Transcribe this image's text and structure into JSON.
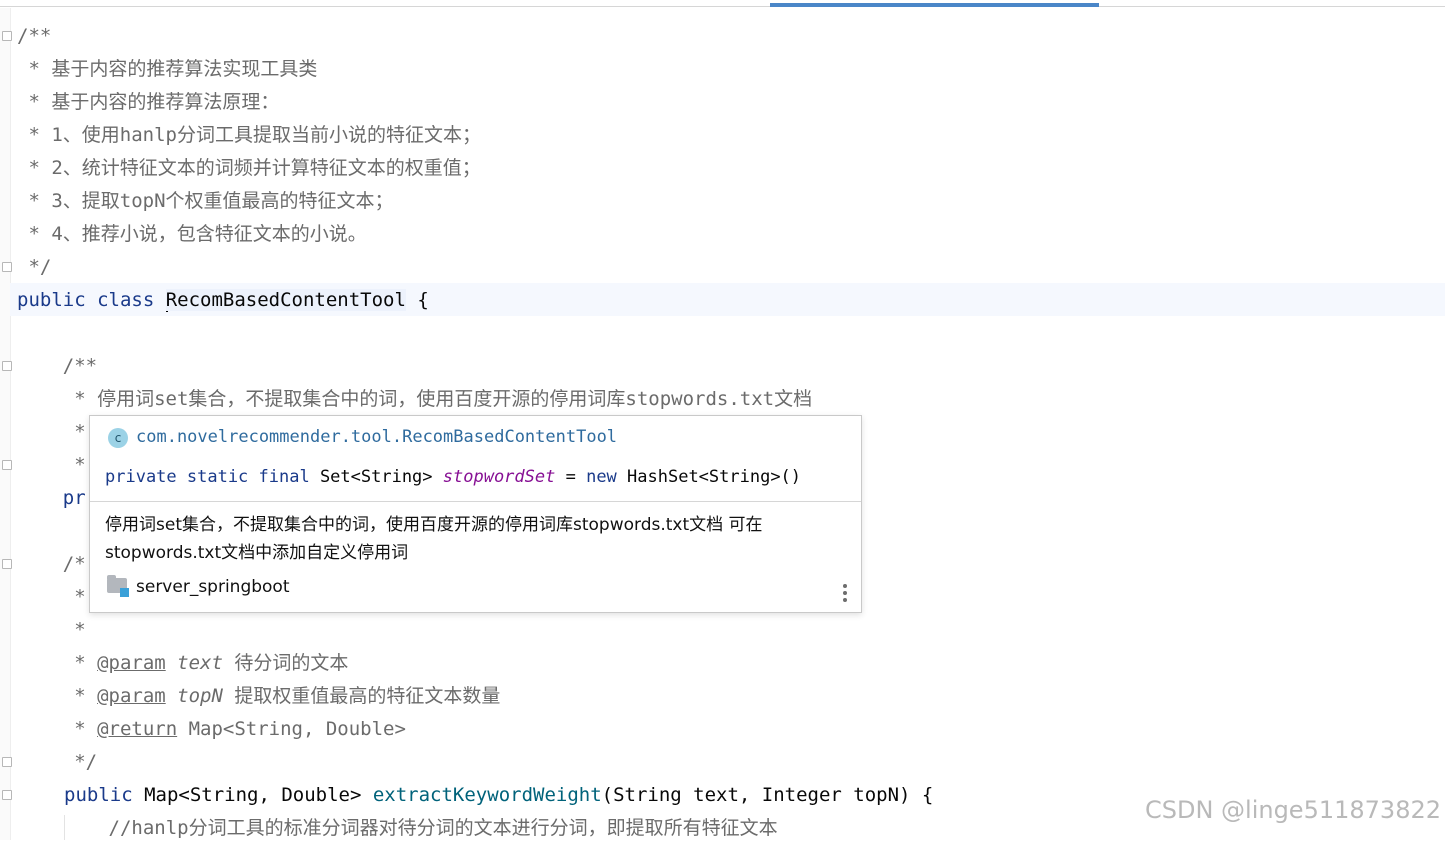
{
  "editor": {
    "lines": {
      "l1": "/**",
      "l2": " * 基于内容的推荐算法实现工具类",
      "l3": " * 基于内容的推荐算法原理：",
      "l4": " * 1、使用hanlp分词工具提取当前小说的特征文本；",
      "l5": " * 2、统计特征文本的词频并计算特征文本的权重值；",
      "l6": " * 3、提取topN个权重值最高的特征文本；",
      "l7": " * 4、推荐小说，包含特征文本的小说。",
      "l8": " */",
      "l9_kw": "public class ",
      "l9_cls": "RecomBasedContentTool",
      "l9_tail": " {",
      "l10": "    /**",
      "l11": "     * 停用词set集合，不提取集合中的词，使用百度开源的停用词库stopwords.txt文档",
      "l12": "     *",
      "l13": "     *",
      "l14": "    pr",
      "l15": "    /*",
      "l16": "     *",
      "l17": "     *",
      "l18_pre": "     * ",
      "l18_tag": "@param",
      "l18_name": "text",
      "l18_desc": " 待分词的文本",
      "l19_pre": "     * ",
      "l19_tag": "@param",
      "l19_name": "topN",
      "l19_desc": " 提取权重值最高的特征文本数量",
      "l20_pre": "     * ",
      "l20_tag": "@return",
      "l20_desc": " Map<String, Double>",
      "l21": "     */",
      "l22_kw": "public",
      "l22_type": " Map<String, Double> ",
      "l22_fn": "extractKeywordWeight",
      "l22_rest": "(String text, Integer topN) {",
      "l23": "        //hanlp分词工具的标准分词器对待分词的文本进行分词，即提取所有特征文本"
    }
  },
  "popup": {
    "icon_letter": "c",
    "qualified_name": "com.novelrecommender.tool.RecomBasedContentTool",
    "decl_kw": "private static final",
    "decl_type": " Set<String> ",
    "decl_field": "stopwordSet",
    "decl_eq": " = ",
    "decl_new": "new",
    "decl_init": " HashSet<String>()",
    "doc_text": "停用词set集合，不提取集合中的词，使用百度开源的停用词库stopwords.txt文档 可在stopwords.txt文档中添加自定义停用词",
    "module": "server_springboot"
  },
  "watermark": "CSDN @linge511873822"
}
